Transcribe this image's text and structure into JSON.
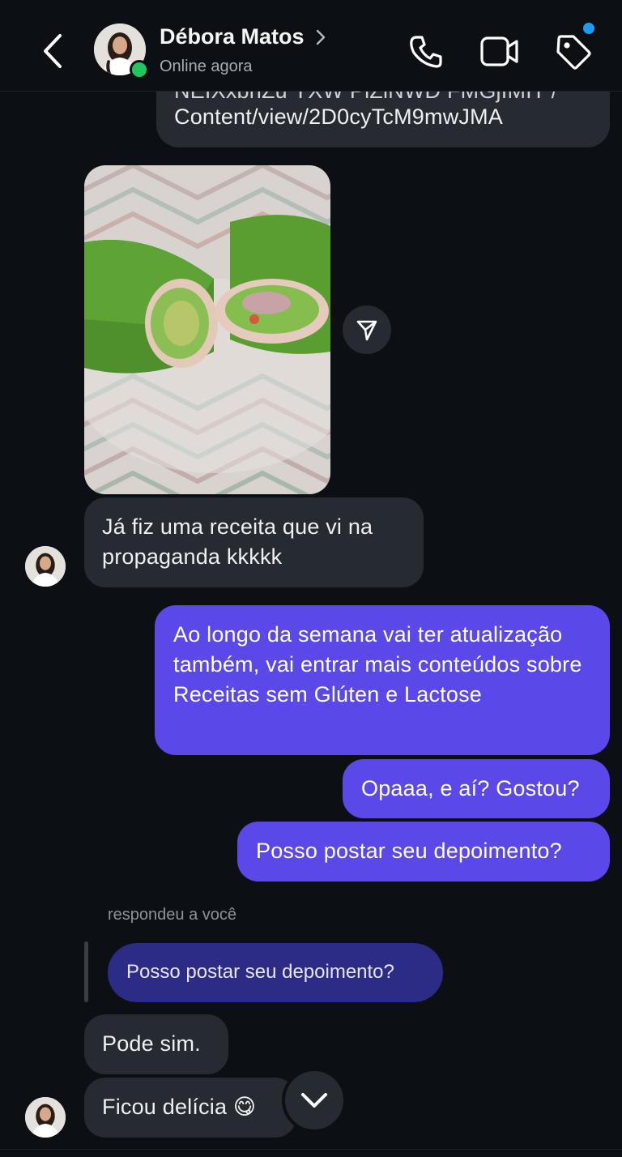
{
  "header": {
    "contact_name": "Débora Matos",
    "status": "Online agora"
  },
  "messages": {
    "link_partial_top": "NEIXxbnZu YXW PiZiNWD FMGjIMIT /",
    "link_text": "Content/view/2D0cyTcM9mwJMA",
    "received_1": "Já fiz uma receita que vi na propaganda kkkkk",
    "sent_1": "Ao longo da semana vai ter atualização também, vai entrar mais conteúdos sobre Receitas sem Glúten e Lactose",
    "sent_2": "Opaaa, e aí? Gostou?",
    "sent_3": "Posso postar seu depoimento?",
    "reply_label": "respondeu a você",
    "quoted": "Posso postar seu depoimento?",
    "received_2": "Pode sim.",
    "received_3": "Ficou delícia 😋"
  },
  "colors": {
    "background": "#0c0f14",
    "received_bubble": "#262a31",
    "sent_bubble": "#5a48e8",
    "quoted_bubble": "#2c2b85",
    "online_dot": "#22c55e",
    "notification_dot": "#1d9bf0"
  },
  "icons": {
    "back": "chevron-left-icon",
    "call": "phone-icon",
    "video": "video-camera-icon",
    "tag": "tag-icon",
    "share": "paper-plane-icon",
    "scroll_down": "chevron-down-icon"
  }
}
